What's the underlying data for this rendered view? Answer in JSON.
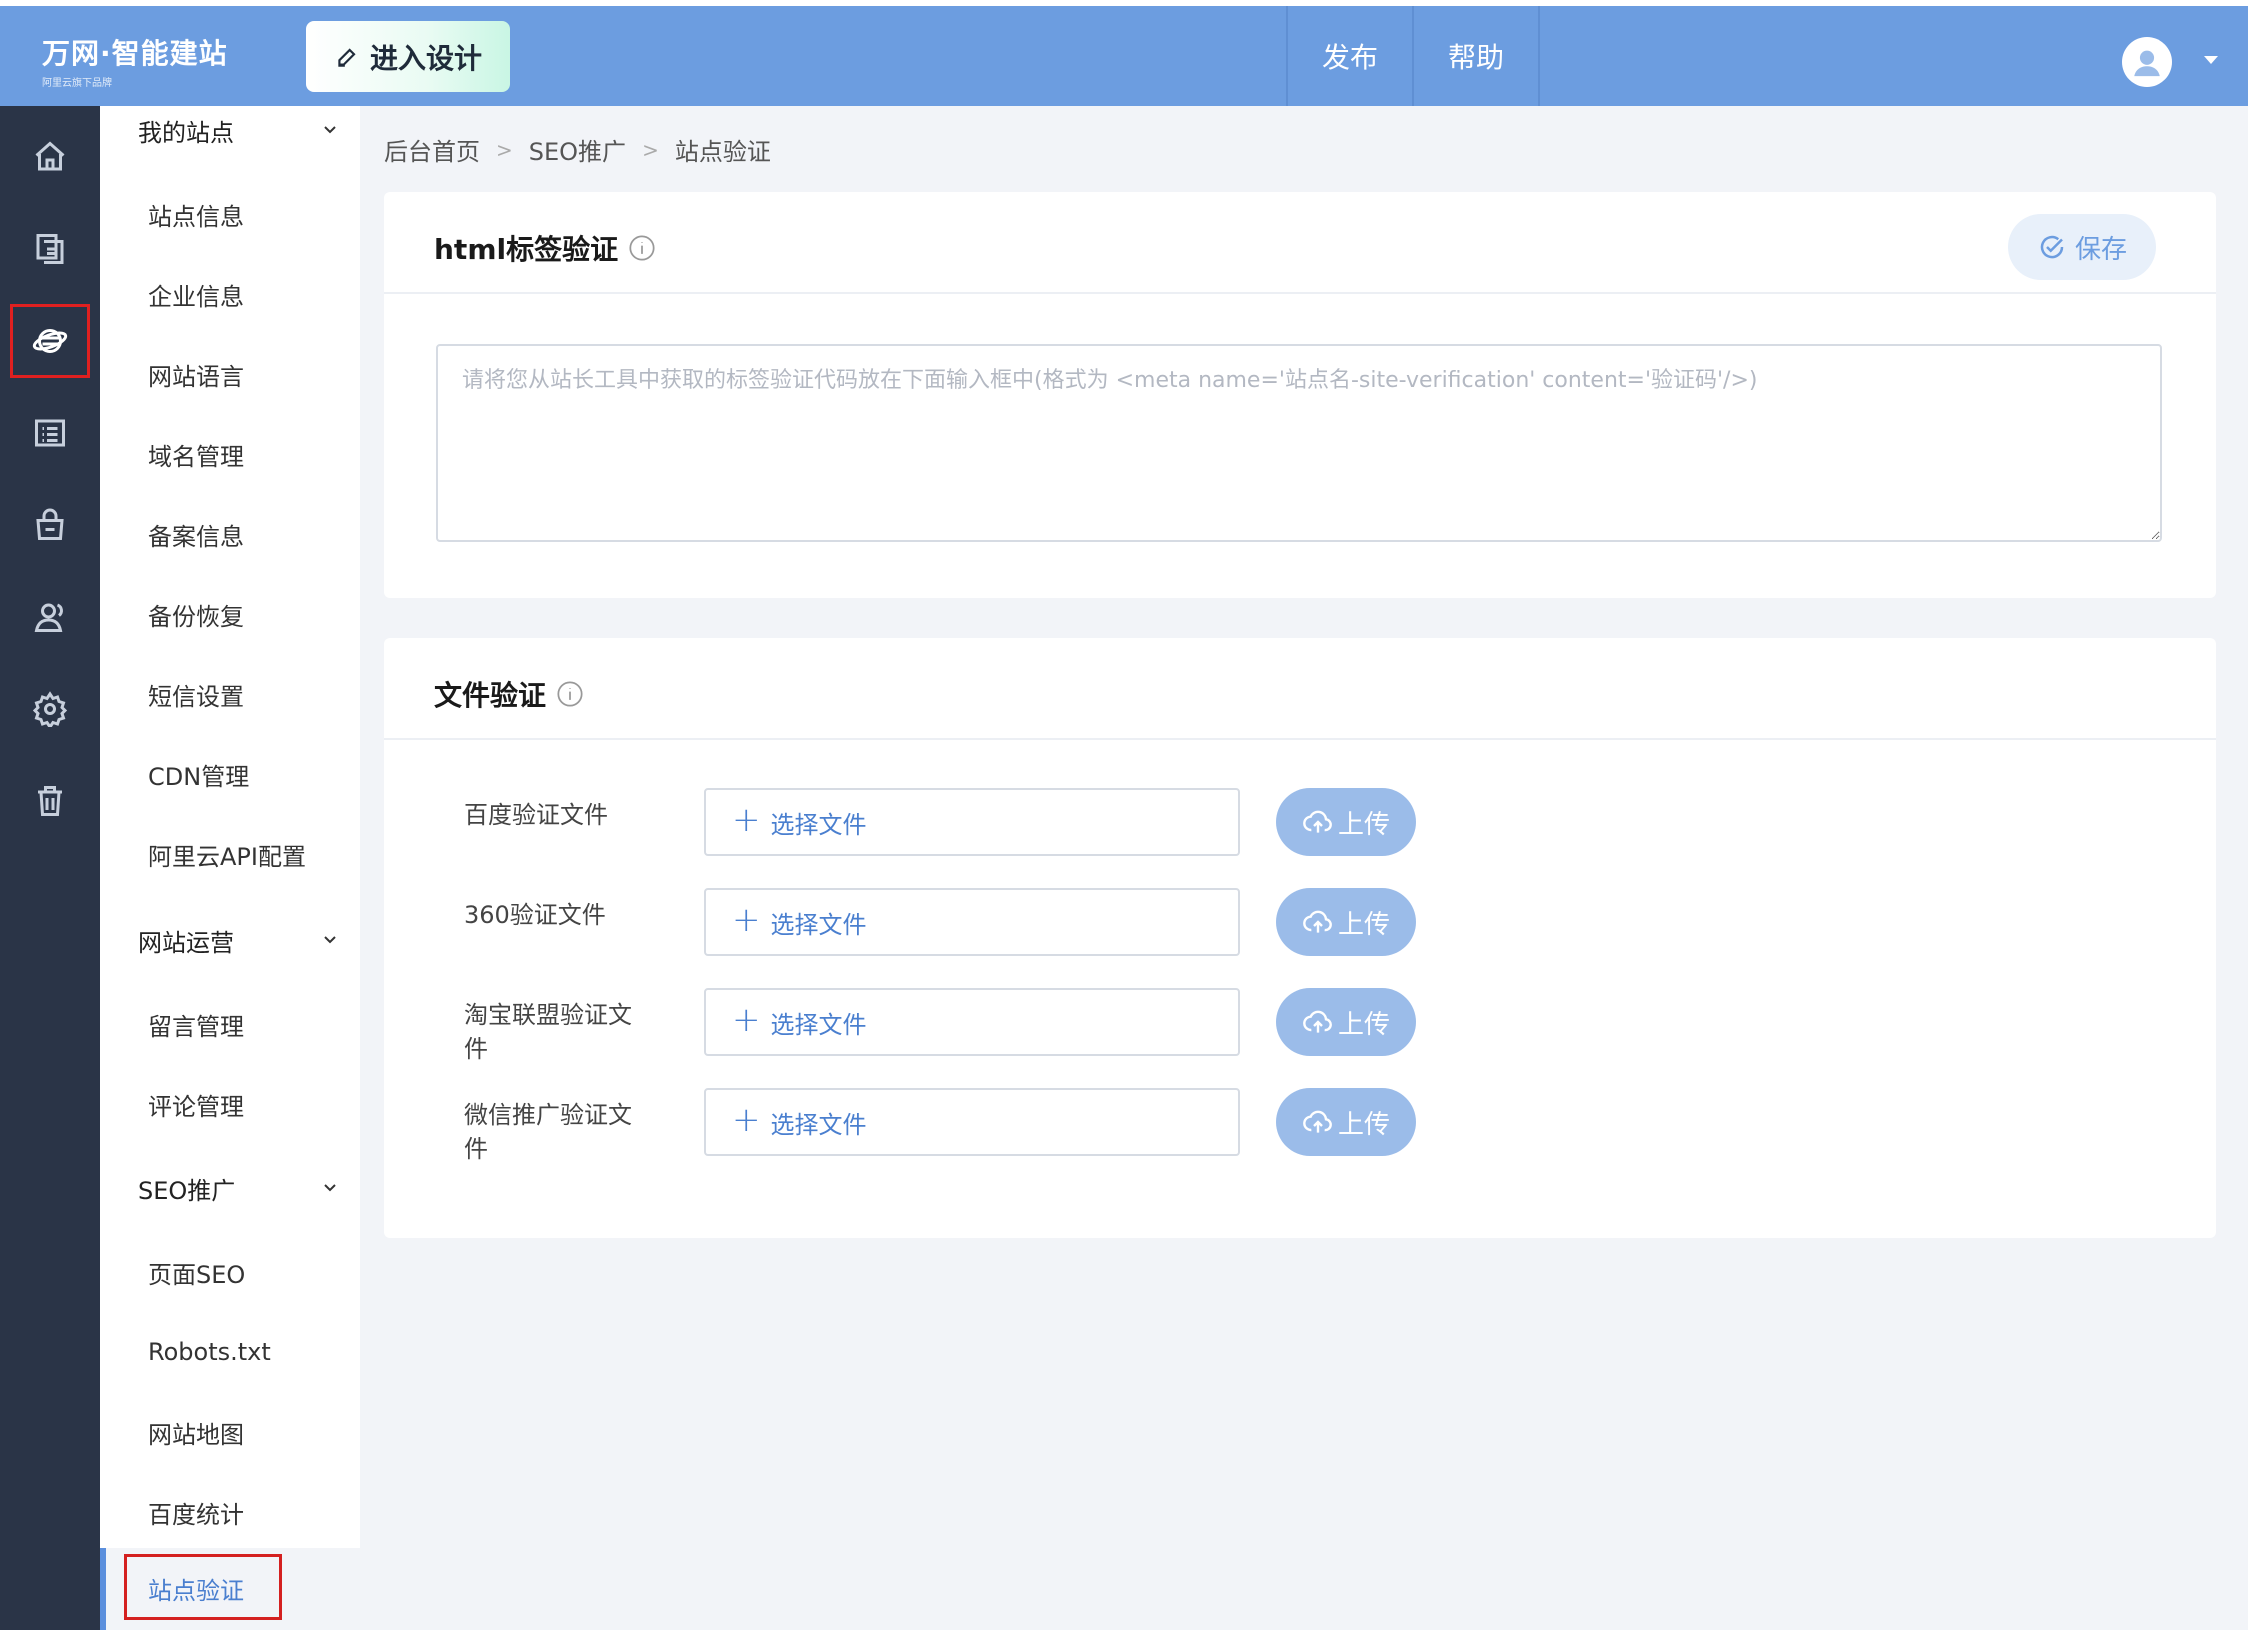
{
  "header": {
    "logo_text": "万网·智能建站",
    "logo_sub": "阿里云旗下品牌",
    "design_button": "进入设计",
    "publish": "发布",
    "help": "帮助"
  },
  "rail": {
    "items": [
      "home-icon",
      "pages-icon",
      "seo-globe-icon",
      "list-icon",
      "shop-icon",
      "users-icon",
      "settings-icon",
      "trash-icon"
    ],
    "active": "seo-globe-icon"
  },
  "sidebar": {
    "my_site": "我的站点",
    "my_site_items": [
      "站点信息",
      "企业信息",
      "网站语言",
      "域名管理",
      "备案信息",
      "备份恢复",
      "短信设置",
      "CDN管理",
      "阿里云API配置"
    ],
    "operations": "网站运营",
    "operations_items": [
      "留言管理",
      "评论管理"
    ],
    "seo": "SEO推广",
    "seo_items": [
      "页面SEO",
      "Robots.txt",
      "网站地图",
      "百度统计",
      "站点验证"
    ],
    "active_item": "站点验证"
  },
  "breadcrumb": [
    "后台首页",
    "SEO推广",
    "站点验证"
  ],
  "html_card": {
    "title": "html标签验证",
    "save": "保存",
    "placeholder": "请将您从站长工具中获取的标签验证代码放在下面输入框中(格式为 <meta name='站点名-site-verification' content='验证码'/>)",
    "value": ""
  },
  "file_card": {
    "title": "文件验证",
    "select_label": "选择文件",
    "upload_label": "上传",
    "rows": [
      {
        "label": "百度验证文件"
      },
      {
        "label": "360验证文件"
      },
      {
        "label": "淘宝联盟验证文件"
      },
      {
        "label": "微信推广验证文件"
      }
    ]
  },
  "colors": {
    "header": "#6c9de0",
    "rail": "#2a3447",
    "accent": "#4a7fcf",
    "upload": "#9bbce9"
  }
}
